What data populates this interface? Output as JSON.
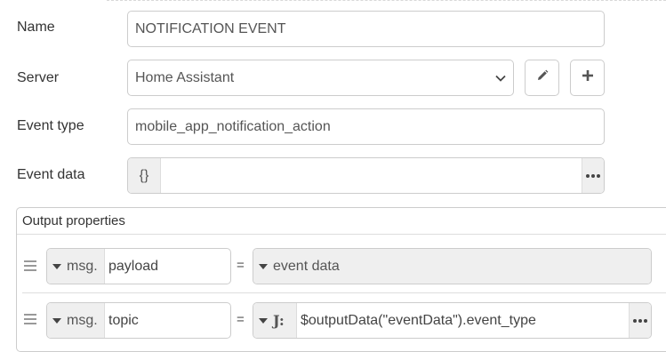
{
  "form": {
    "name_label": "Name",
    "name_value": "NOTIFICATION EVENT",
    "server_label": "Server",
    "server_value": "Home Assistant",
    "event_type_label": "Event type",
    "event_type_value": "mobile_app_notification_action",
    "event_data_label": "Event data",
    "event_data_type_icon": "{}",
    "event_data_value": ""
  },
  "output_properties": {
    "title": "Output properties",
    "rows": [
      {
        "prefix": "msg.",
        "property": "payload",
        "operator": "=",
        "value_type": "event data",
        "value": ""
      },
      {
        "prefix": "msg.",
        "property": "topic",
        "operator": "=",
        "value_type_icon": "J:",
        "value": "$outputData(\"eventData\").event_type"
      }
    ]
  },
  "icons": {
    "edit_server": "pencil-icon",
    "add_server": "plus-icon",
    "select_arrow": "chevron-down-icon",
    "expand": "ellipsis-icon",
    "drag": "drag-handle-icon",
    "jsonata": "jsonata-icon"
  }
}
